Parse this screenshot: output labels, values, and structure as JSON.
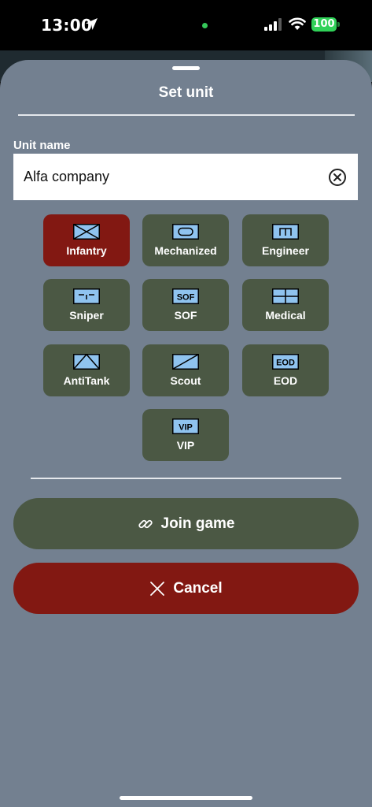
{
  "status_bar": {
    "time": "13:00",
    "battery": "100",
    "icons": [
      "location-arrow-icon",
      "signal-icon",
      "wifi-icon",
      "battery-icon"
    ]
  },
  "sheet": {
    "title": "Set unit"
  },
  "unit_name": {
    "label": "Unit name",
    "value": "Alfa company",
    "clear_icon": "clear-circle-x-icon"
  },
  "units": [
    {
      "id": "infantry",
      "label": "Infantry",
      "symbol": "",
      "selected": true
    },
    {
      "id": "mechanized",
      "label": "Mechanized",
      "symbol": "",
      "selected": false
    },
    {
      "id": "engineer",
      "label": "Engineer",
      "symbol": "",
      "selected": false
    },
    {
      "id": "sniper",
      "label": "Sniper",
      "symbol": "",
      "selected": false
    },
    {
      "id": "sof",
      "label": "SOF",
      "symbol": "SOF",
      "selected": false
    },
    {
      "id": "medical",
      "label": "Medical",
      "symbol": "",
      "selected": false
    },
    {
      "id": "antitank",
      "label": "AntiTank",
      "symbol": "",
      "selected": false
    },
    {
      "id": "scout",
      "label": "Scout",
      "symbol": "",
      "selected": false
    },
    {
      "id": "eod",
      "label": "EOD",
      "symbol": "EOD",
      "selected": false
    },
    {
      "id": "vip",
      "label": "VIP",
      "symbol": "VIP",
      "selected": false
    }
  ],
  "actions": {
    "join_label": "Join game",
    "join_icon": "link-icon",
    "cancel_label": "Cancel",
    "cancel_icon": "close-x-icon"
  },
  "colors": {
    "sheet_background": "#738090",
    "unit_button": "#4b5844",
    "unit_selected": "#821812",
    "symbol_fill": "#8fc3ef",
    "join_button": "#4b5844",
    "cancel_button": "#821812"
  }
}
